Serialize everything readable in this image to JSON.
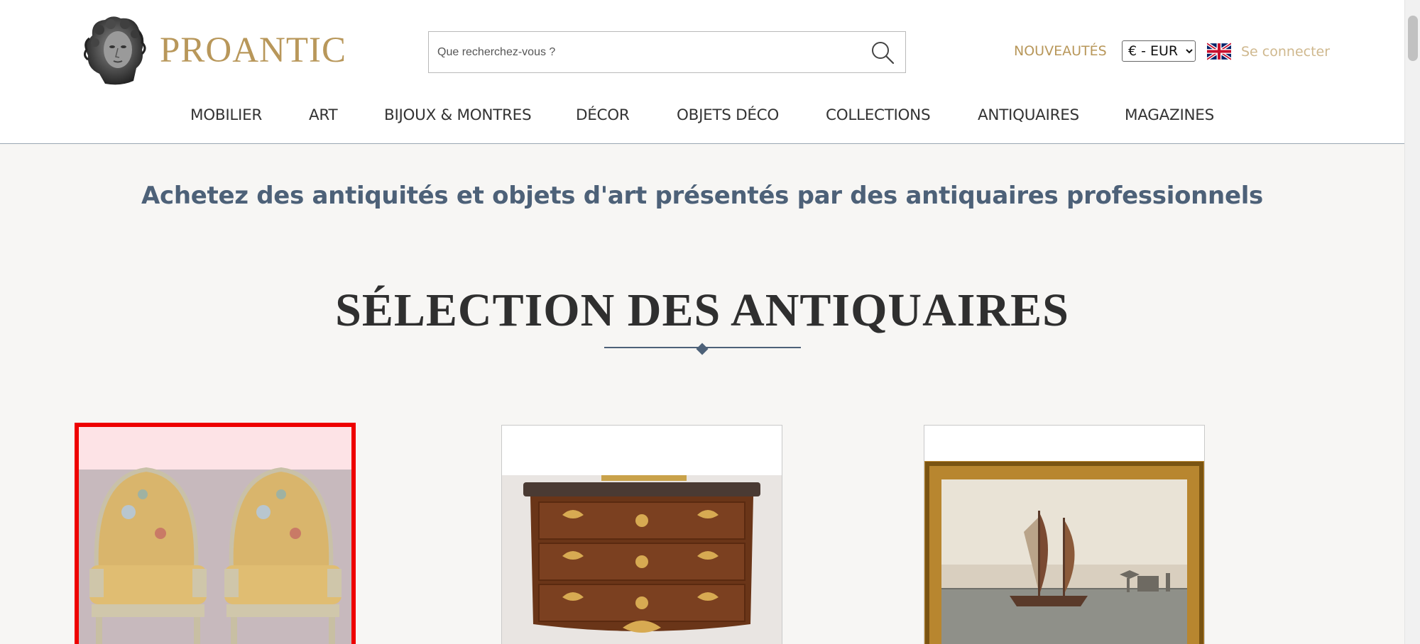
{
  "header": {
    "logo_text": "PROANTIC",
    "logo_icon": "classical-bust-icon",
    "search": {
      "placeholder": "Que recherchez-vous ?",
      "icon": "search-icon"
    },
    "nouveautes": "NOUVEAUTÉS",
    "currency": {
      "selected": "€ - EUR"
    },
    "language_flag": "uk-flag-icon",
    "login": "Se connecter"
  },
  "nav": {
    "items": [
      {
        "label": "MOBILIER"
      },
      {
        "label": "ART"
      },
      {
        "label": "BIJOUX & MONTRES"
      },
      {
        "label": "DÉCOR"
      },
      {
        "label": "OBJETS DÉCO"
      },
      {
        "label": "COLLECTIONS"
      },
      {
        "label": "ANTIQUAIRES"
      },
      {
        "label": "MAGAZINES"
      }
    ]
  },
  "main": {
    "tagline": "Achetez des antiquités et objets d'art présentés par des antiquaires professionnels",
    "section_title": "SÉLECTION DES ANTIQUAIRES",
    "cards": [
      {
        "subject": "pair-of-bergere-armchairs",
        "selected": true
      },
      {
        "subject": "marquetry-commode",
        "selected": false
      },
      {
        "subject": "framed-marine-painting",
        "selected": false
      }
    ]
  },
  "colors": {
    "brand_gold": "#b8975a",
    "slate": "#4d6178",
    "selection_red": "#ee0000",
    "page_bg": "#f7f6f4"
  }
}
